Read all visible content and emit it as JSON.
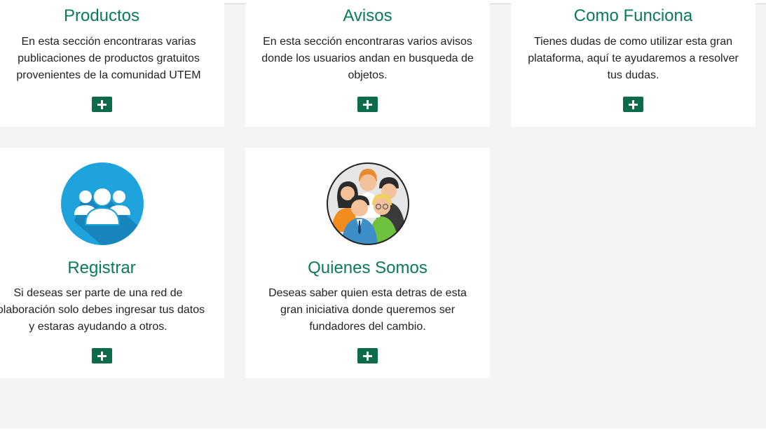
{
  "colors": {
    "title": "#0b7a5a",
    "button": "#0b6b4b",
    "background": "#f4f4f4",
    "card": "#ffffff"
  },
  "cards": [
    {
      "title": "Productos",
      "lines": [
        "En esta sección encontraras varias",
        "publicaciones de productos gratuitos",
        "provenientes de la comunidad UTEM"
      ],
      "button_icon": "plus-icon"
    },
    {
      "title": "Avisos",
      "lines": [
        "En esta sección encontraras varios avisos",
        "donde los usuarios andan en busqueda de",
        "objetos."
      ],
      "button_icon": "plus-icon"
    },
    {
      "title": "Como Funciona",
      "lines": [
        "Tienes dudas de como utilizar esta gran",
        "plataforma, aquí te ayudaremos a resolver",
        "tus dudas."
      ],
      "button_icon": "plus-icon"
    },
    {
      "title": "Registrar",
      "lines": [
        "Si deseas ser parte de una red de",
        "colaboración solo debes ingresar tus datos",
        "y estaras ayudando a otros."
      ],
      "image_icon": "users-group-icon",
      "button_icon": "plus-icon"
    },
    {
      "title": "Quienes Somos",
      "lines": [
        "Deseas saber quien esta detras de esta",
        "gran iniciativa donde queremos ser",
        "fundadores del cambio."
      ],
      "image_icon": "team-people-icon",
      "button_icon": "plus-icon"
    }
  ]
}
